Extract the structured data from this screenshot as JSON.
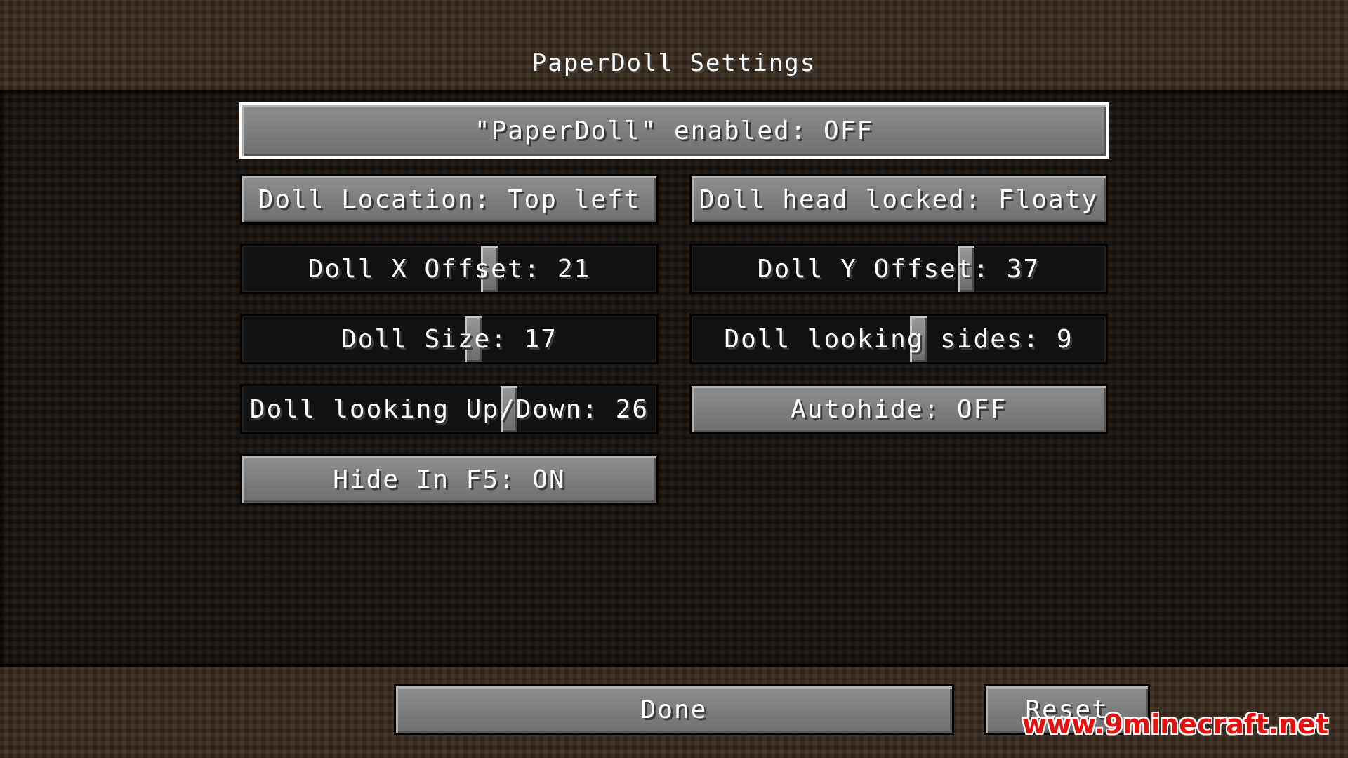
{
  "screen": {
    "title": "PaperDoll Settings"
  },
  "options": {
    "enabled": "\"PaperDoll\" enabled: OFF",
    "location": "Doll Location: Top left",
    "head_locked": "Doll head locked: Floaty",
    "x_offset": {
      "label": "Doll X Offset: 21",
      "level": 0.6
    },
    "y_offset": {
      "label": "Doll Y Offset: 37",
      "level": 0.67
    },
    "size": {
      "label": "Doll Size: 17",
      "level": 0.56
    },
    "looking_sides": {
      "label": "Doll looking sides: 9",
      "level": 0.55
    },
    "looking_updown": {
      "label": "Doll looking Up/Down: 26",
      "level": 0.65
    },
    "autohide": "Autohide: OFF",
    "hide_in_f5": "Hide In F5: ON"
  },
  "footer": {
    "done_label": "Done",
    "reset_label": "Reset"
  },
  "watermark": {
    "text": "www.9minecraft.net",
    "color": "#e01212"
  }
}
